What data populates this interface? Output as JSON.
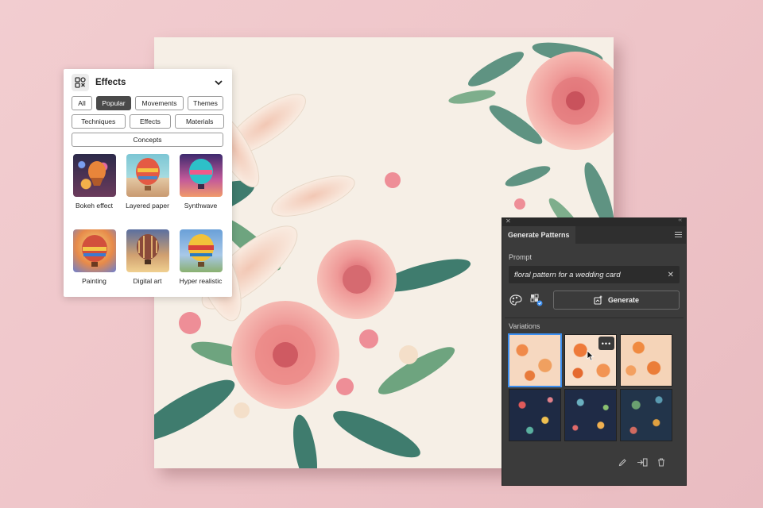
{
  "effects_panel": {
    "title": "Effects",
    "filters": {
      "all": "All",
      "popular": "Popular",
      "movements": "Movements",
      "themes": "Themes",
      "techniques": "Techniques",
      "effects": "Effects",
      "materials": "Materials",
      "concepts": "Concepts"
    },
    "active_filter": "Popular",
    "styles": [
      {
        "label": "Bokeh effect"
      },
      {
        "label": "Layered paper"
      },
      {
        "label": "Synthwave"
      },
      {
        "label": "Painting"
      },
      {
        "label": "Digital art"
      },
      {
        "label": "Hyper realistic"
      }
    ],
    "icons": {
      "panel": "effects-grid-icon",
      "collapse": "chevron-down-icon"
    }
  },
  "generate_patterns": {
    "tab_title": "Generate Patterns",
    "prompt_label": "Prompt",
    "prompt_value": "floral pattern for a wedding card",
    "generate_label": "Generate",
    "variations_label": "Variations",
    "more_label": "•••",
    "selected_variation": 1,
    "icons": {
      "clear": "close-icon",
      "style": "palette-icon",
      "options": "pattern-options-icon",
      "generate": "generate-icon",
      "edit": "pencil-icon",
      "apply": "apply-icon",
      "delete": "trash-icon",
      "menu": "menu-icon"
    }
  },
  "colors": {
    "accent": "#3d8ff0",
    "panel_dark": "#3b3b3b",
    "chip_active": "#4a4a4a",
    "background": "#f0c9cd",
    "canvas": "#f6efe6"
  }
}
